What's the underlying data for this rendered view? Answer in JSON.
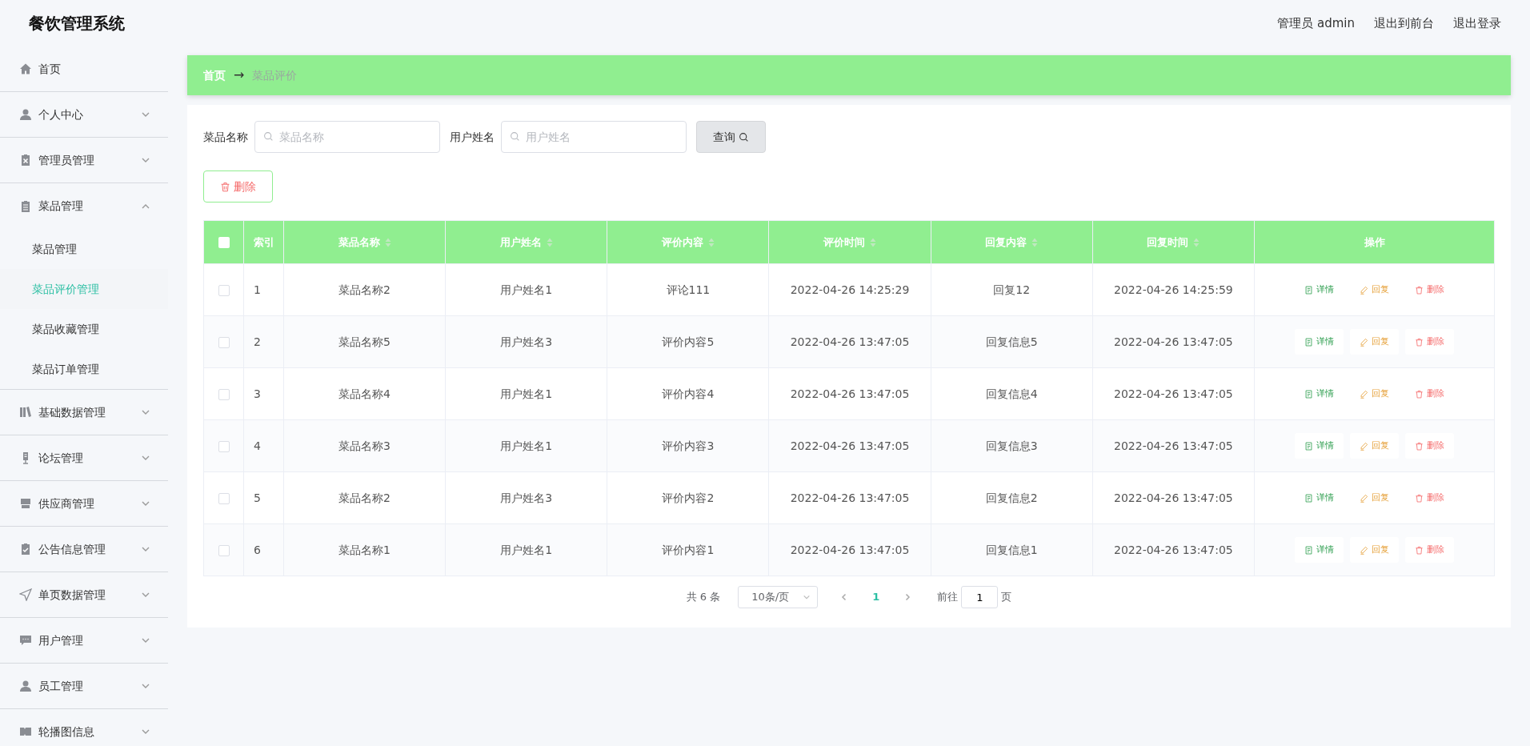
{
  "app_title": "餐饮管理系统",
  "header_links": [
    "管理员 admin",
    "退出到前台",
    "退出登录"
  ],
  "sidebar": {
    "items": [
      {
        "label": "首页",
        "kind": "link"
      },
      {
        "label": "个人中心",
        "kind": "menu",
        "expanded": false
      },
      {
        "label": "管理员管理",
        "kind": "menu",
        "expanded": false
      },
      {
        "label": "菜品管理",
        "kind": "menu",
        "expanded": true,
        "children": [
          {
            "label": "菜品管理",
            "selected": false
          },
          {
            "label": "菜品评价管理",
            "selected": true
          },
          {
            "label": "菜品收藏管理",
            "selected": false
          },
          {
            "label": "菜品订单管理",
            "selected": false
          }
        ]
      },
      {
        "label": "基础数据管理",
        "kind": "menu",
        "expanded": false
      },
      {
        "label": "论坛管理",
        "kind": "menu",
        "expanded": false
      },
      {
        "label": "供应商管理",
        "kind": "menu",
        "expanded": false
      },
      {
        "label": "公告信息管理",
        "kind": "menu",
        "expanded": false
      },
      {
        "label": "单页数据管理",
        "kind": "menu",
        "expanded": false
      },
      {
        "label": "用户管理",
        "kind": "menu",
        "expanded": false
      },
      {
        "label": "员工管理",
        "kind": "menu",
        "expanded": false
      },
      {
        "label": "轮播图信息",
        "kind": "menu",
        "expanded": false
      }
    ]
  },
  "breadcrumb": [
    "首页",
    "→",
    "菜品评价"
  ],
  "search": {
    "fields": [
      {
        "label": "菜品名称",
        "placeholder": "菜品名称"
      },
      {
        "label": "用户姓名",
        "placeholder": "用户姓名"
      }
    ],
    "button": "查询"
  },
  "delete_button": "删除",
  "table": {
    "header_checked": false,
    "columns": [
      {
        "label": "索引",
        "sortable": false
      },
      {
        "label": "菜品名称",
        "sortable": true
      },
      {
        "label": "用户姓名",
        "sortable": true
      },
      {
        "label": "评价内容",
        "sortable": true
      },
      {
        "label": "评价时间",
        "sortable": true
      },
      {
        "label": "回复内容",
        "sortable": true
      },
      {
        "label": "回复时间",
        "sortable": true
      },
      {
        "label": "操作",
        "sortable": false
      }
    ],
    "rows": [
      {
        "checked": false,
        "cells": [
          "1",
          "菜品名称2",
          "用户姓名1",
          "评论111",
          "2022-04-26 14:25:29",
          "回复12",
          "2022-04-26 14:25:59"
        ],
        "actions": [
          {
            "kind": "detail",
            "label": "详情"
          },
          {
            "kind": "reply",
            "label": "回复"
          },
          {
            "kind": "delete",
            "label": "删除"
          }
        ]
      },
      {
        "checked": false,
        "cells": [
          "2",
          "菜品名称5",
          "用户姓名3",
          "评价内容5",
          "2022-04-26 13:47:05",
          "回复信息5",
          "2022-04-26 13:47:05"
        ],
        "actions": [
          {
            "kind": "detail",
            "label": "详情"
          },
          {
            "kind": "reply",
            "label": "回复"
          },
          {
            "kind": "delete",
            "label": "删除"
          }
        ]
      },
      {
        "checked": false,
        "cells": [
          "3",
          "菜品名称4",
          "用户姓名1",
          "评价内容4",
          "2022-04-26 13:47:05",
          "回复信息4",
          "2022-04-26 13:47:05"
        ],
        "actions": [
          {
            "kind": "detail",
            "label": "详情"
          },
          {
            "kind": "reply",
            "label": "回复"
          },
          {
            "kind": "delete",
            "label": "删除"
          }
        ]
      },
      {
        "checked": false,
        "cells": [
          "4",
          "菜品名称3",
          "用户姓名1",
          "评价内容3",
          "2022-04-26 13:47:05",
          "回复信息3",
          "2022-04-26 13:47:05"
        ],
        "actions": [
          {
            "kind": "detail",
            "label": "详情"
          },
          {
            "kind": "reply",
            "label": "回复"
          },
          {
            "kind": "delete",
            "label": "删除"
          }
        ]
      },
      {
        "checked": false,
        "cells": [
          "5",
          "菜品名称2",
          "用户姓名3",
          "评价内容2",
          "2022-04-26 13:47:05",
          "回复信息2",
          "2022-04-26 13:47:05"
        ],
        "actions": [
          {
            "kind": "detail",
            "label": "详情"
          },
          {
            "kind": "reply",
            "label": "回复"
          },
          {
            "kind": "delete",
            "label": "删除"
          }
        ]
      },
      {
        "checked": false,
        "cells": [
          "6",
          "菜品名称1",
          "用户姓名1",
          "评价内容1",
          "2022-04-26 13:47:05",
          "回复信息1",
          "2022-04-26 13:47:05"
        ],
        "actions": [
          {
            "kind": "detail",
            "label": "详情"
          },
          {
            "kind": "reply",
            "label": "回复"
          },
          {
            "kind": "delete",
            "label": "删除"
          }
        ]
      }
    ]
  },
  "pagination": {
    "total": "共 6 条",
    "page_size": "10条/页",
    "pages": [
      {
        "label": "1",
        "selected": true
      }
    ],
    "goto_label": "前往",
    "goto_value": "1",
    "page_suffix": "页"
  }
}
